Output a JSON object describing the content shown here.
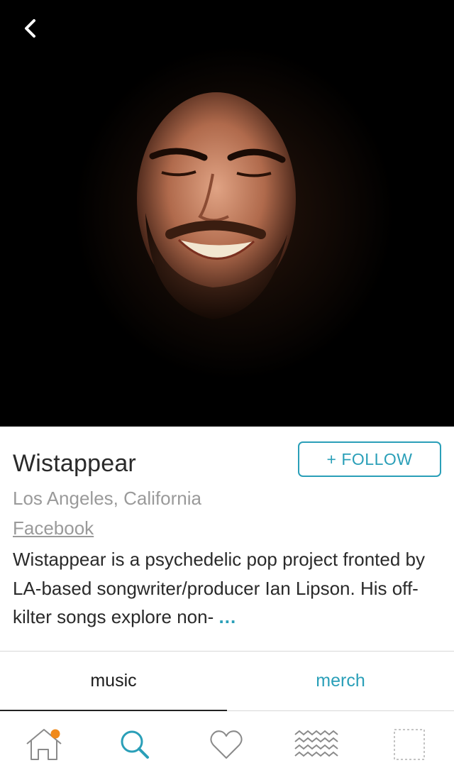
{
  "artist": {
    "name": "Wistappear",
    "location": "Los Angeles, California",
    "link_label": "Facebook",
    "bio": "Wistappear is a psychedelic pop project fronted by LA-based songwriter/producer Ian Lipson. His off-kilter songs explore non-",
    "more_label": "..."
  },
  "actions": {
    "follow_label": "+ FOLLOW"
  },
  "tabs": [
    {
      "label": "music",
      "active": true
    },
    {
      "label": "merch",
      "active": false
    }
  ],
  "nav": {
    "items": [
      {
        "icon": "home-icon",
        "badge": true
      },
      {
        "icon": "search-icon",
        "active": true
      },
      {
        "icon": "heart-icon"
      },
      {
        "icon": "waves-icon"
      },
      {
        "icon": "placeholder-square-icon"
      }
    ]
  },
  "colors": {
    "accent": "#2a9fb8",
    "badge": "#f08a1c",
    "text": "#2a2a2a",
    "muted": "#9a9a9a"
  }
}
